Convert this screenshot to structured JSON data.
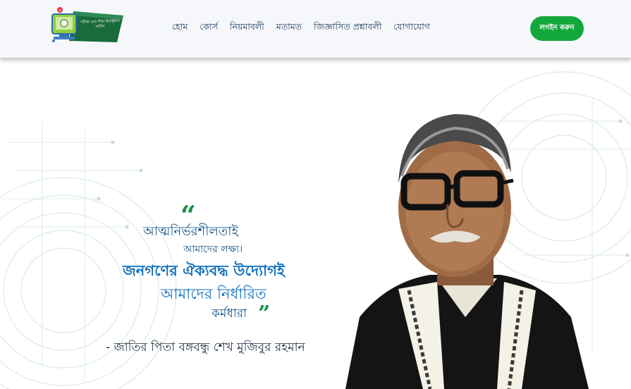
{
  "header": {
    "logo_text": "পরীক্ষা এবং শিক্ষা ইলেক্ট্রনিক সার্ভিস",
    "nav": [
      {
        "label": "হোম"
      },
      {
        "label": "কোর্স"
      },
      {
        "label": "নিয়মাবলী"
      },
      {
        "label": "মতামত"
      },
      {
        "label": "জিজ্ঞাসিত প্রশ্নাবলী"
      },
      {
        "label": "যোগাযোগ"
      }
    ],
    "login_label": "লগইন করুন"
  },
  "hero": {
    "quote_open": "“",
    "quote_close": "”",
    "lines": [
      "আত্মনির্ভরশীলতাই",
      "আমাদের লক্ষ্য।",
      "জনগণের ঐক্যবদ্ধ উদ্যোগই",
      "আমাদের নির্ধারিত",
      "কর্মধারা"
    ],
    "attribution": "- জাতির পিতা বঙ্গবন্ধু শেখ মুজিবুর রহমান"
  },
  "colors": {
    "brand_green": "#14a83c",
    "quote_green": "#159246",
    "quote_blue": "#0f6fbf",
    "nav_text": "#1c3b56"
  }
}
